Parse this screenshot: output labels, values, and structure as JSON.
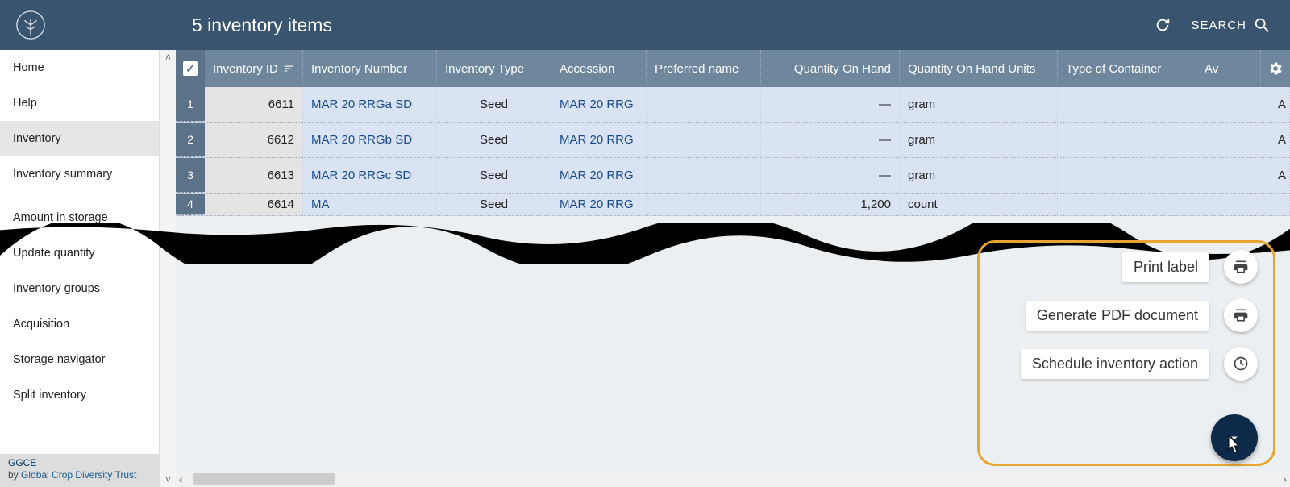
{
  "header": {
    "title": "5 inventory items",
    "search_label": "SEARCH"
  },
  "sidebar": {
    "items": [
      {
        "label": "Home",
        "active": false
      },
      {
        "label": "Help",
        "active": false
      },
      {
        "label": "Inventory",
        "active": true
      },
      {
        "label": "Inventory summary",
        "active": false
      },
      {
        "label": "Amount in storage",
        "active": false
      },
      {
        "label": "Update quantity",
        "active": false
      },
      {
        "label": "Inventory groups",
        "active": false
      },
      {
        "label": "Acquisition",
        "active": false
      },
      {
        "label": "Storage navigator",
        "active": false
      },
      {
        "label": "Split inventory",
        "active": false
      }
    ],
    "footer": {
      "name": "GGCE",
      "by": "by ",
      "org": "Global Crop Diversity Trust"
    }
  },
  "table": {
    "columns": {
      "id": "Inventory ID",
      "num": "Inventory Number",
      "type": "Inventory Type",
      "acc": "Accession",
      "name": "Preferred name",
      "qty": "Quantity On Hand",
      "units": "Quantity On Hand Units",
      "cont": "Type of Container",
      "av": "Av"
    },
    "rows": [
      {
        "n": "1",
        "id": "6611",
        "num": "MAR 20 RRGa SD",
        "type": "Seed",
        "acc": "MAR 20 RRG",
        "qty": "—",
        "units": "gram",
        "av": "A"
      },
      {
        "n": "2",
        "id": "6612",
        "num": "MAR 20 RRGb SD",
        "type": "Seed",
        "acc": "MAR 20 RRG",
        "qty": "—",
        "units": "gram",
        "av": "A"
      },
      {
        "n": "3",
        "id": "6613",
        "num": "MAR 20 RRGc SD",
        "type": "Seed",
        "acc": "MAR 20 RRG",
        "qty": "—",
        "units": "gram",
        "av": "A"
      },
      {
        "n": "4",
        "id": "6614",
        "num": "MA",
        "type": "Seed",
        "acc": "MAR 20 RRG",
        "qty": "1,200",
        "units": "count",
        "av": ""
      }
    ]
  },
  "fab": {
    "print_label": "Print label",
    "generate_pdf": "Generate PDF document",
    "schedule": "Schedule inventory action"
  }
}
